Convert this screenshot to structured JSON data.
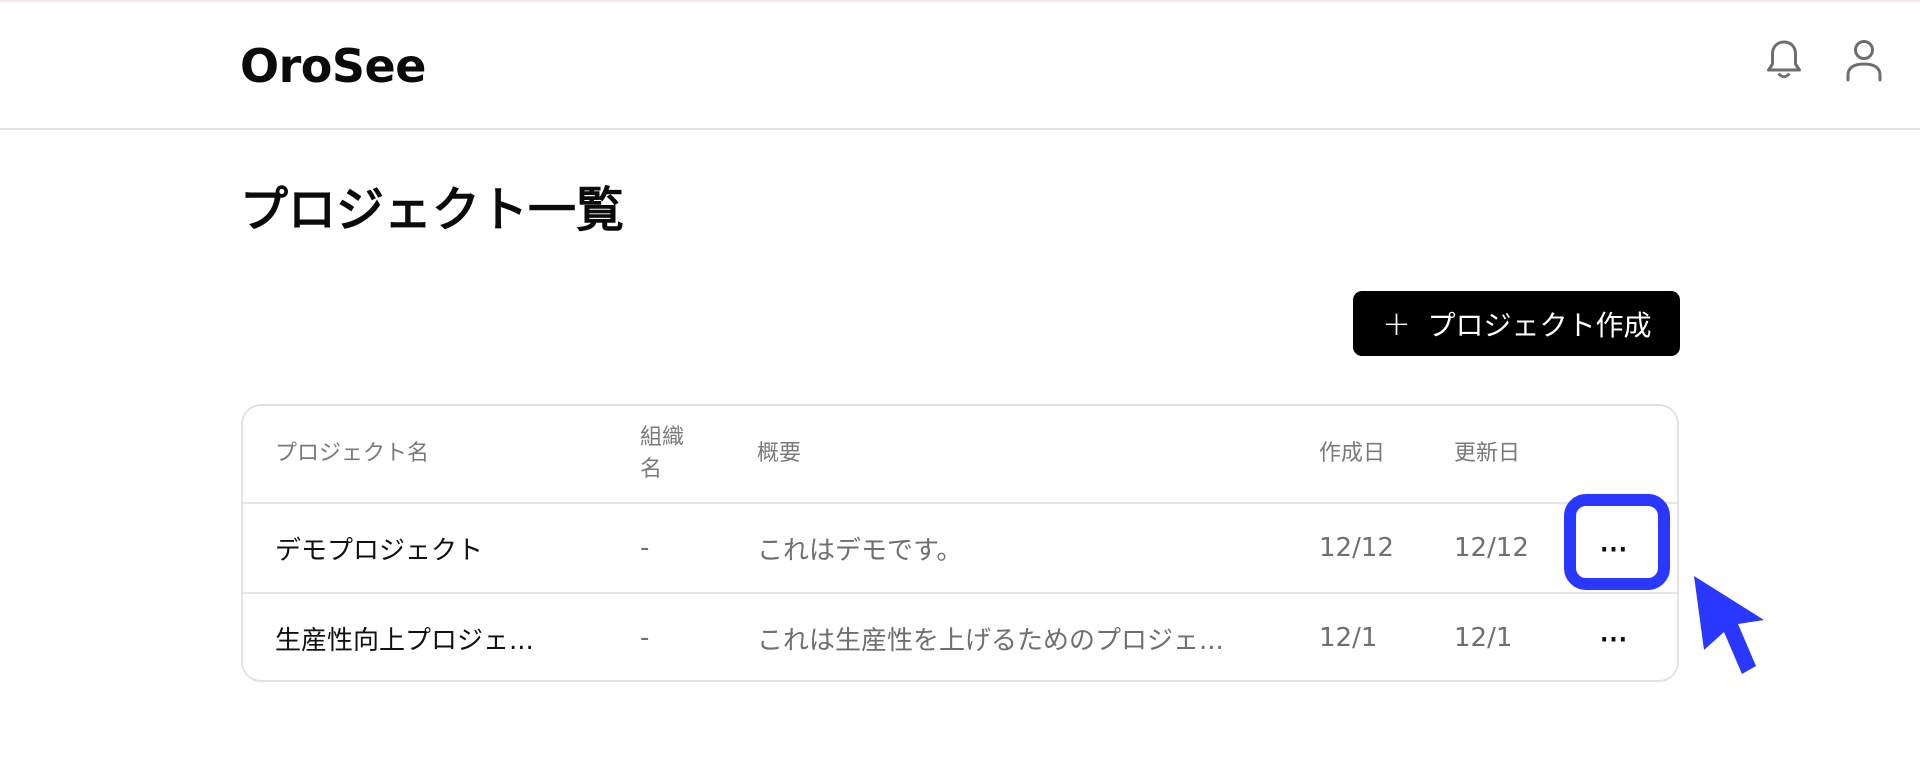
{
  "app": {
    "name": "OroSee"
  },
  "header": {
    "notifications_icon": "bell-icon",
    "account_icon": "user-icon"
  },
  "page": {
    "title": "プロジェクト一覧"
  },
  "toolbar": {
    "create_icon": "plus-icon",
    "create_label": "プロジェクト作成"
  },
  "table": {
    "columns": {
      "name": "プロジェクト名",
      "org": "組織名",
      "description": "概要",
      "created": "作成日",
      "updated": "更新日"
    },
    "rows": [
      {
        "name": "デモプロジェクト",
        "org": "-",
        "description": "これはデモです。",
        "created": "12/12",
        "updated": "12/12",
        "actions": "⋯"
      },
      {
        "name": "生産性向上プロジェ...",
        "org": "-",
        "description": "これは生産性を上げるためのプロジェ...",
        "created": "12/1",
        "updated": "12/1",
        "actions": "⋯"
      }
    ]
  },
  "annotation": {
    "highlight_color": "#2a37ff",
    "cursor_icon": "cursor-arrow-icon"
  }
}
